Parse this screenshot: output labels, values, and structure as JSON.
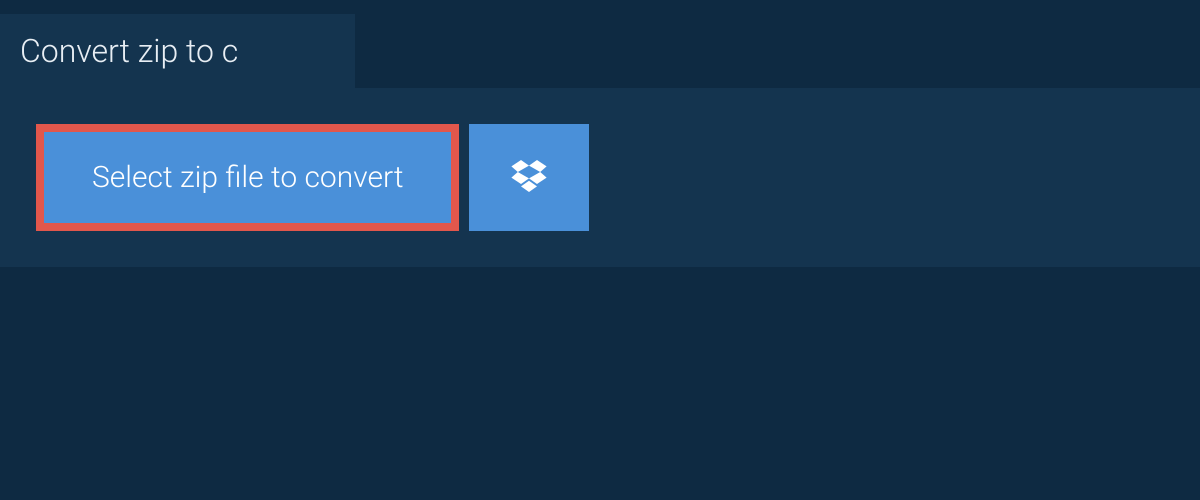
{
  "tab": {
    "title": "Convert zip to c"
  },
  "actions": {
    "select_file_label": "Select zip file to convert"
  },
  "colors": {
    "background_dark": "#0e2a42",
    "panel": "#14344f",
    "button_primary": "#4a90d9",
    "highlight_border": "#e2574c",
    "text_light": "#e8eef4",
    "text_white": "#ffffff"
  }
}
